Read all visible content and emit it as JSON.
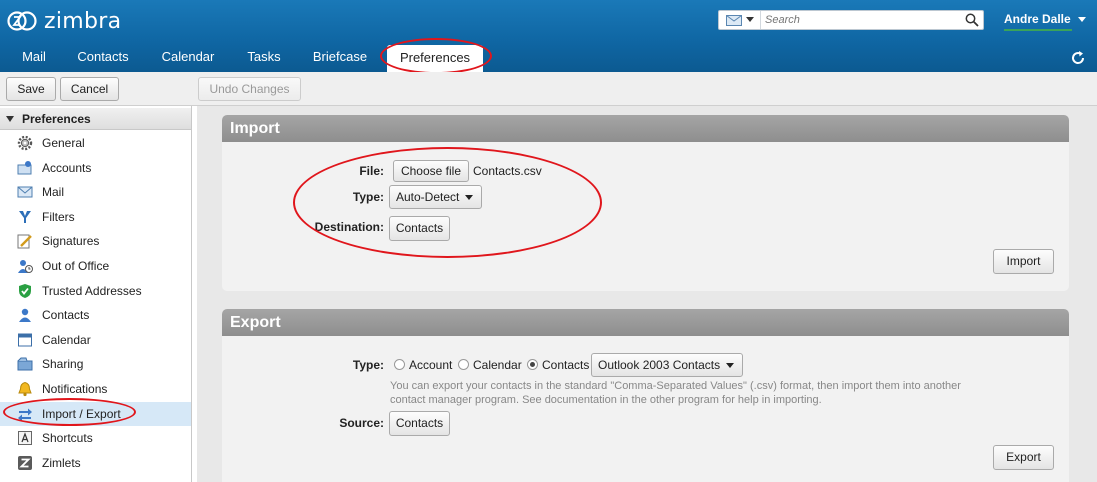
{
  "app": {
    "logo_text": "zimbra"
  },
  "search": {
    "placeholder": "Search"
  },
  "user": {
    "name": "Andre Dalle"
  },
  "nav": {
    "tabs": [
      "Mail",
      "Contacts",
      "Calendar",
      "Tasks",
      "Briefcase",
      "Preferences"
    ],
    "active": "Preferences"
  },
  "toolbar": {
    "save": "Save",
    "cancel": "Cancel",
    "undo": "Undo Changes"
  },
  "sidebar": {
    "header": "Preferences",
    "items": [
      {
        "label": "General",
        "icon": "gear-icon"
      },
      {
        "label": "Accounts",
        "icon": "accounts-icon"
      },
      {
        "label": "Mail",
        "icon": "mail-icon"
      },
      {
        "label": "Filters",
        "icon": "filter-icon"
      },
      {
        "label": "Signatures",
        "icon": "signature-icon"
      },
      {
        "label": "Out of Office",
        "icon": "out-of-office-icon"
      },
      {
        "label": "Trusted Addresses",
        "icon": "shield-check-icon"
      },
      {
        "label": "Contacts",
        "icon": "contact-icon"
      },
      {
        "label": "Calendar",
        "icon": "calendar-icon"
      },
      {
        "label": "Sharing",
        "icon": "sharing-icon"
      },
      {
        "label": "Notifications",
        "icon": "bell-icon"
      },
      {
        "label": "Import / Export",
        "icon": "import-export-icon",
        "selected": true
      },
      {
        "label": "Shortcuts",
        "icon": "keyboard-icon"
      },
      {
        "label": "Zimlets",
        "icon": "zimlet-icon"
      }
    ]
  },
  "import": {
    "title": "Import",
    "file_label": "File:",
    "choose_file": "Choose file",
    "file_name": "Contacts.csv",
    "type_label": "Type:",
    "type_value": "Auto-Detect",
    "destination_label": "Destination:",
    "destination_value": "Contacts",
    "import_button": "Import"
  },
  "export": {
    "title": "Export",
    "type_label": "Type:",
    "options": [
      "Account",
      "Calendar",
      "Contacts"
    ],
    "selected_option": "Contacts",
    "format_value": "Outlook 2003 Contacts",
    "hint_line1": "You can export your contacts in the standard \"Comma-Separated Values\" (.csv) format, then import them into another",
    "hint_line2": "contact manager program. See documentation in the other program for help in importing.",
    "source_label": "Source:",
    "source_value": "Contacts",
    "export_button": "Export"
  },
  "colors": {
    "header_blue": "#1a79b8",
    "annotation_red": "#e0161c",
    "selected_row": "#d6e8f7"
  }
}
